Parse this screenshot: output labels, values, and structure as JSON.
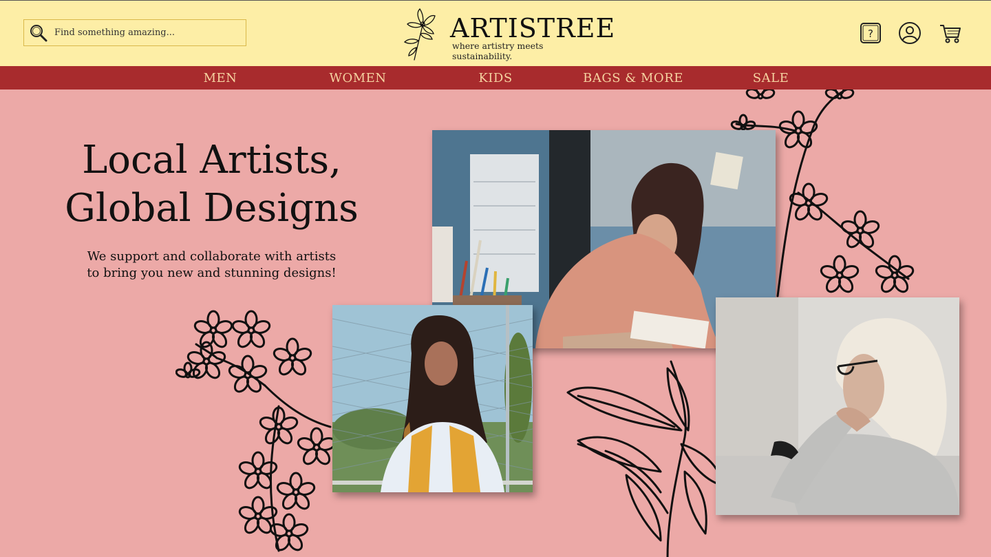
{
  "search": {
    "placeholder": "Find something amazing...",
    "icon": "search-icon"
  },
  "brand": {
    "name": "ARTISTREE",
    "tagline": "where artistry meets sustainability."
  },
  "header_icons": [
    "help-icon",
    "account-icon",
    "cart-icon"
  ],
  "nav": [
    {
      "label": "MEN"
    },
    {
      "label": "WOMEN"
    },
    {
      "label": "KIDS"
    },
    {
      "label": "BAGS & MORE"
    },
    {
      "label": "SALE"
    }
  ],
  "hero": {
    "title_line1": "Local Artists,",
    "title_line2": "Global Designs",
    "subtitle_line1": "We support and collaborate with artists",
    "subtitle_line2": "to bring you new and stunning designs!"
  },
  "colors": {
    "header_bg": "#fdeea6",
    "nav_bg": "#a82b2d",
    "nav_text": "#f5d2a0",
    "page_bg": "#eca9a7"
  }
}
